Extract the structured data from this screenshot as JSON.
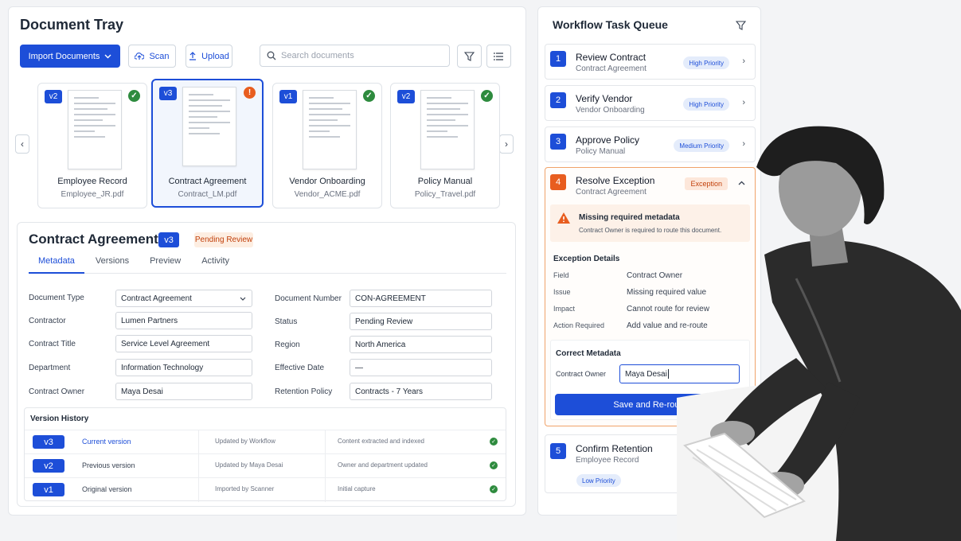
{
  "tray": {
    "title": "Document Tray",
    "import_label": "Import Documents",
    "scan_label": "Scan",
    "upload_label": "Upload",
    "search_placeholder": "Search documents",
    "documents": [
      {
        "version": "v2",
        "name": "Employee Record",
        "file": "Employee_JR.pdf",
        "status": "ok"
      },
      {
        "version": "v3",
        "name": "Contract Agreement",
        "file": "Contract_LM.pdf",
        "status": "warning"
      },
      {
        "version": "v1",
        "name": "Vendor Onboarding",
        "file": "Vendor_ACME.pdf",
        "status": "ok"
      },
      {
        "version": "v2",
        "name": "Policy Manual",
        "file": "Policy_Travel.pdf",
        "status": "ok"
      }
    ]
  },
  "detail": {
    "title": "Contract Agreement",
    "version": "v3",
    "status": "Pending Review",
    "tabs": [
      "Metadata",
      "Versions",
      "Preview",
      "Activity"
    ],
    "left_fields": [
      {
        "label": "Document Type",
        "value": "Contract Agreement"
      },
      {
        "label": "Contractor",
        "value": "Lumen Partners"
      },
      {
        "label": "Contract Title",
        "value": "Service Level Agreement"
      },
      {
        "label": "Department",
        "value": "Information Technology"
      },
      {
        "label": "Contract Owner",
        "value": "Maya Desai"
      }
    ],
    "right_fields": [
      {
        "label": "Document Number",
        "value": "CON-AGREEMENT"
      },
      {
        "label": "Status",
        "value": "Pending Review"
      },
      {
        "label": "Region",
        "value": "North America"
      },
      {
        "label": "Effective Date",
        "value": "—"
      },
      {
        "label": "Retention Policy",
        "value": "Contracts - 7 Years"
      }
    ],
    "version_history": {
      "title": "Version History",
      "rows": [
        {
          "version": "v3",
          "label": "Current version",
          "by": "Updated by Workflow",
          "note": "Content extracted and indexed"
        },
        {
          "version": "v2",
          "label": "Previous version",
          "by": "Updated by Maya Desai",
          "note": "Owner and department updated"
        },
        {
          "version": "v1",
          "label": "Original version",
          "by": "Imported by Scanner",
          "note": "Initial capture"
        }
      ]
    }
  },
  "queue": {
    "title": "Workflow Task Queue",
    "tasks": [
      {
        "num": "1",
        "title": "Review Contract",
        "sub": "Contract Agreement",
        "priority": "High Priority"
      },
      {
        "num": "2",
        "title": "Verify Vendor",
        "sub": "Vendor Onboarding",
        "priority": "High Priority"
      },
      {
        "num": "3",
        "title": "Approve Policy",
        "sub": "Policy Manual",
        "priority": "Medium Priority"
      }
    ],
    "exception": {
      "num": "4",
      "title": "Resolve Exception",
      "sub": "Contract Agreement",
      "badge": "Exception",
      "alert_title": "Missing required metadata",
      "alert_text": "Contract Owner is required to route this document.",
      "details_title": "Exception Details",
      "details": [
        {
          "key": "Field",
          "value": "Contract Owner"
        },
        {
          "key": "Issue",
          "value": "Missing required value"
        },
        {
          "key": "Impact",
          "value": "Cannot route for review"
        },
        {
          "key": "Action Required",
          "value": "Add value and re-route"
        }
      ],
      "correct_title": "Correct Metadata",
      "field_label": "Contract Owner",
      "field_value": "Maya Desai",
      "button_label": "Save and Re-route"
    },
    "last_task": {
      "num": "5",
      "title": "Confirm Retention",
      "sub": "Employee Record",
      "priority": "Low Priority"
    }
  },
  "colors": {
    "accent": "#1d4ed8",
    "success": "#2e8b3e",
    "warning": "#e85d1f"
  }
}
